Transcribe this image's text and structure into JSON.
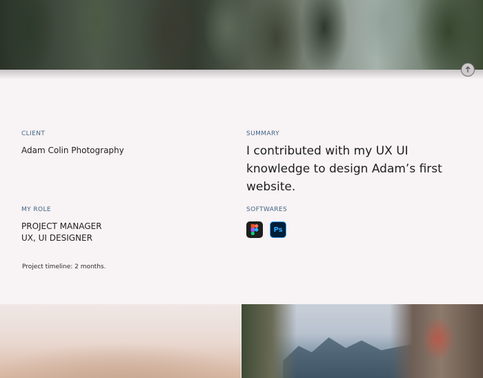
{
  "project": {
    "client_label": "CLIENT",
    "client_value": "Adam Colin Photography",
    "summary_label": "SUMMARY",
    "summary_text": "I contributed with my UX UI knowledge to design Adam’s first website.",
    "role_label": "MY ROLE",
    "role_lines": [
      "PROJECT MANAGER",
      "UX, UI DESIGNER"
    ],
    "softwares_label": "SOFTWARES",
    "softwares": [
      {
        "name": "figma-icon"
      },
      {
        "name": "photoshop-icon",
        "text": "Ps"
      }
    ],
    "timeline": "Project timeline: 2 months."
  },
  "colors": {
    "background": "#f8f3f4",
    "label": "#3f6386",
    "photoshop_accent": "#31a8ff"
  }
}
